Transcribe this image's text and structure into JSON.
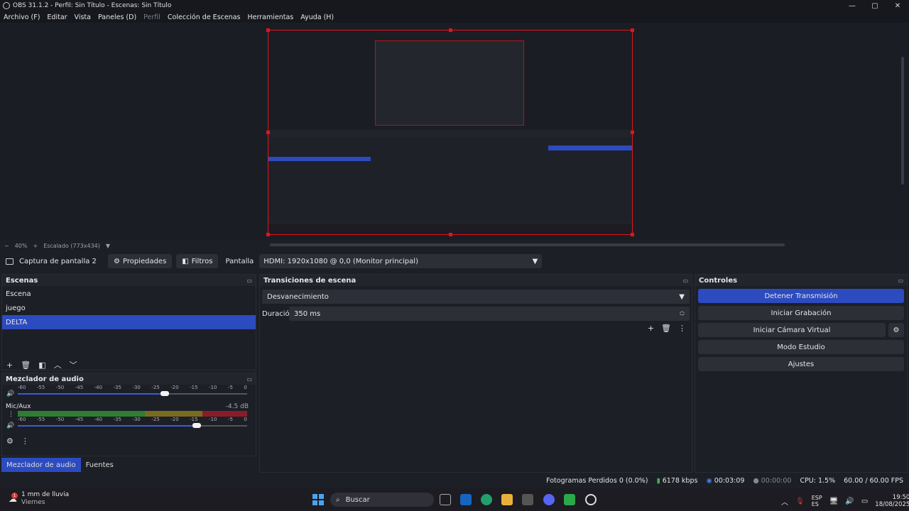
{
  "window": {
    "title": "OBS 31.1.2 - Perfil: Sin Título - Escenas: Sin Título",
    "controls": [
      "—",
      "▢",
      "✕"
    ]
  },
  "menu": [
    {
      "label": "Archivo (F)",
      "enabled": true
    },
    {
      "label": "Editar",
      "enabled": true
    },
    {
      "label": "Vista",
      "enabled": true
    },
    {
      "label": "Paneles (D)",
      "enabled": true
    },
    {
      "label": "Perfil",
      "enabled": false
    },
    {
      "label": "Colección de Escenas",
      "enabled": true
    },
    {
      "label": "Herramientas",
      "enabled": true
    },
    {
      "label": "Ayuda (H)",
      "enabled": true
    }
  ],
  "preview": {
    "zoom_minus": "−",
    "zoom": "40%",
    "zoom_plus": "+",
    "scaling": "Escalado (773x434)"
  },
  "source_toolbar": {
    "source_name": "Captura de pantalla 2",
    "properties": "Propiedades",
    "filters": "Filtros",
    "display_label": "Pantalla",
    "display_value": "HDMI: 1920x1080 @ 0,0 (Monitor principal)"
  },
  "scenes": {
    "title": "Escenas",
    "items": [
      "Escena",
      "juego",
      "DELTA"
    ],
    "selected_index": 2
  },
  "mixer": {
    "title": "Mezclador de audio",
    "scale": [
      "-60",
      "-55",
      "-50",
      "-45",
      "-40",
      "-35",
      "-30",
      "-25",
      "-20",
      "-15",
      "-10",
      "-5",
      "0"
    ],
    "channels": [
      {
        "name": "",
        "db": "",
        "volume": 0.64
      },
      {
        "name": "Mic/Aux",
        "db": "-4.5 dB",
        "volume": 0.78
      }
    ]
  },
  "tabs": [
    "Mezclador de audio",
    "Fuentes"
  ],
  "transitions": {
    "title": "Transiciones de escena",
    "type": "Desvanecimiento",
    "duration_label": "Duración",
    "duration_value": "350 ms"
  },
  "controls": {
    "title": "Controles",
    "buttons": [
      "Detener Transmisión",
      "Iniciar Grabación",
      "Iniciar Cámara Virtual",
      "Modo Estudio",
      "Ajustes"
    ]
  },
  "status": {
    "dropped": "Fotogramas Perdidos 0 (0.0%)",
    "bitrate": "6178 kbps",
    "stream_time": "00:03:09",
    "rec_time": "00:00:00",
    "cpu": "CPU: 1.5%",
    "fps": "60.00 / 60.00 FPS"
  },
  "taskbar": {
    "weather": "1 mm de lluvia",
    "day": "Viernes",
    "search": "Buscar",
    "lang1": "ESP",
    "lang2": "ES",
    "time": "19:50",
    "date": "18/08/2025",
    "badge": "1"
  }
}
